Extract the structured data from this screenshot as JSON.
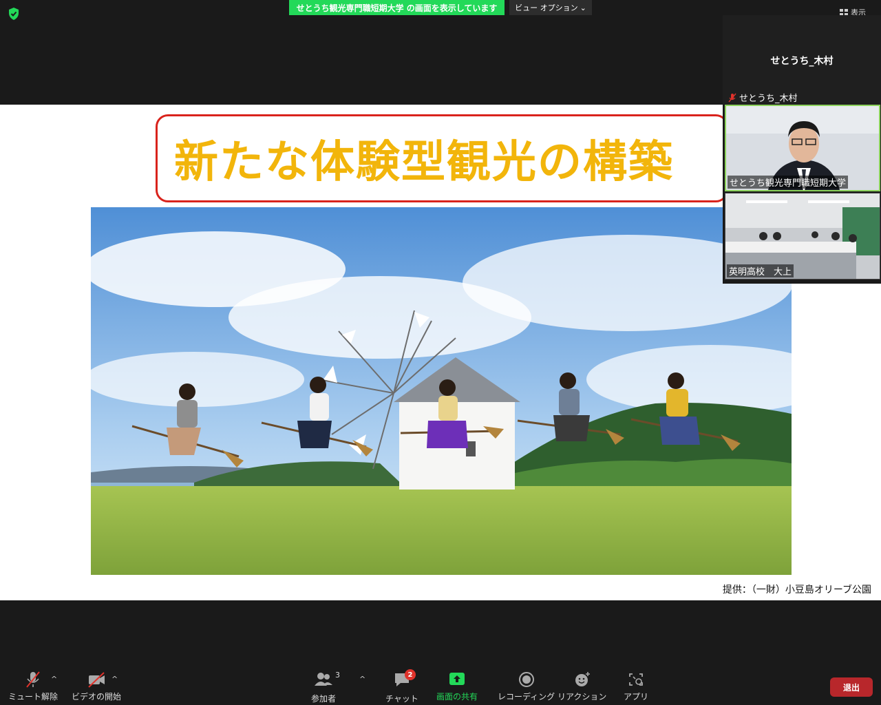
{
  "meeting": {
    "share_banner": "せとうち観光専門職短期大学 の画面を表示しています",
    "view_options": "ビュー オプション",
    "display_label": "表示"
  },
  "slide": {
    "title": "新たな体験型観光の構築",
    "credit": "提供：（一財）小豆島オリーブ公園"
  },
  "participants": {
    "self_name_big": "せとうち_木村",
    "self_name_small": "せとうち_木村",
    "tiles": [
      {
        "label": "せとうち観光専門職短期大学"
      },
      {
        "label": "英明高校　大上"
      }
    ]
  },
  "toolbar": {
    "mute_label": "ミュート解除",
    "video_label": "ビデオの開始",
    "participants_label": "参加者",
    "participants_count": "3",
    "chat_label": "チャット",
    "chat_badge": "2",
    "share_label": "画面の共有",
    "record_label": "レコーディング",
    "reactions_label": "リアクション",
    "apps_label": "アプリ",
    "leave_label": "退出"
  },
  "colors": {
    "share_green": "#23d959",
    "leave_red": "#b8272b",
    "title_yellow": "#f2b50b",
    "title_border": "#d9231c"
  }
}
